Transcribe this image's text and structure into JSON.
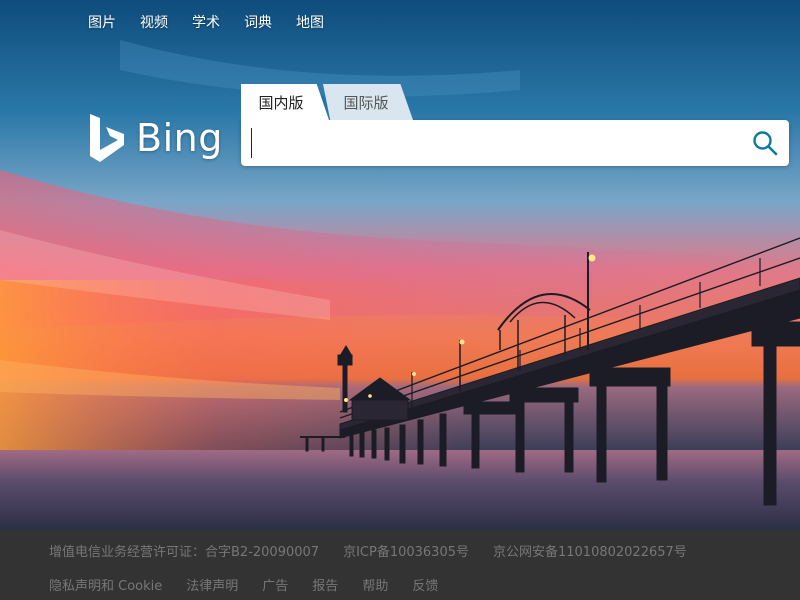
{
  "nav": {
    "items": [
      "图片",
      "视频",
      "学术",
      "词典",
      "地图"
    ]
  },
  "logo": {
    "text": "Bing"
  },
  "search": {
    "tabs": [
      "国内版",
      "国际版"
    ],
    "active_tab": "国内版",
    "value": "",
    "placeholder": ""
  },
  "footer": {
    "licenses": [
      "增值电信业务经营许可证：合字B2-20090007",
      "京ICP备10036305号",
      "京公网安备11010802022657号"
    ],
    "links": [
      "隐私声明和 Cookie",
      "法律声明",
      "广告",
      "报告",
      "帮助",
      "反馈"
    ]
  },
  "colors": {
    "search_icon": "#0e7a9e",
    "footer_bg": "#333333",
    "footer_text": "#777777"
  }
}
